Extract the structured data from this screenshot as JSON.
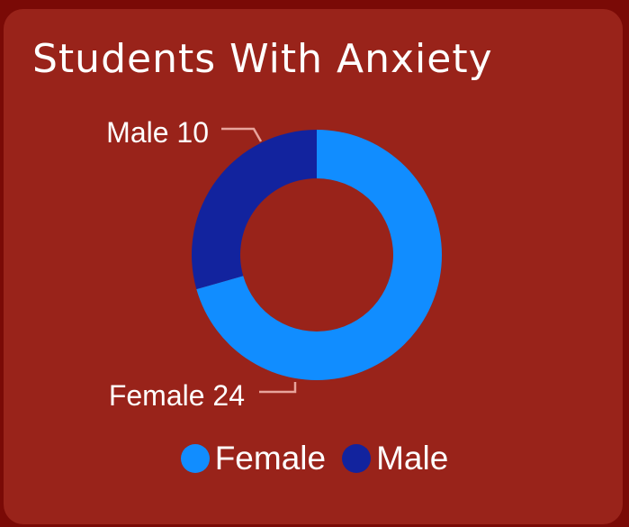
{
  "card": {
    "title": "Students With Anxiety"
  },
  "chart_data": {
    "type": "pie",
    "variant": "donut",
    "title": "Students With Anxiety",
    "categories": [
      "Female",
      "Male"
    ],
    "values": [
      24,
      10
    ],
    "data_labels": [
      "Female 24",
      "Male 10"
    ],
    "colors": [
      "#118dff",
      "#12239e"
    ],
    "legend": "bottom-center"
  },
  "legend": {
    "items": [
      {
        "label": "Female",
        "color": "#118dff"
      },
      {
        "label": "Male",
        "color": "#12239e"
      }
    ]
  }
}
